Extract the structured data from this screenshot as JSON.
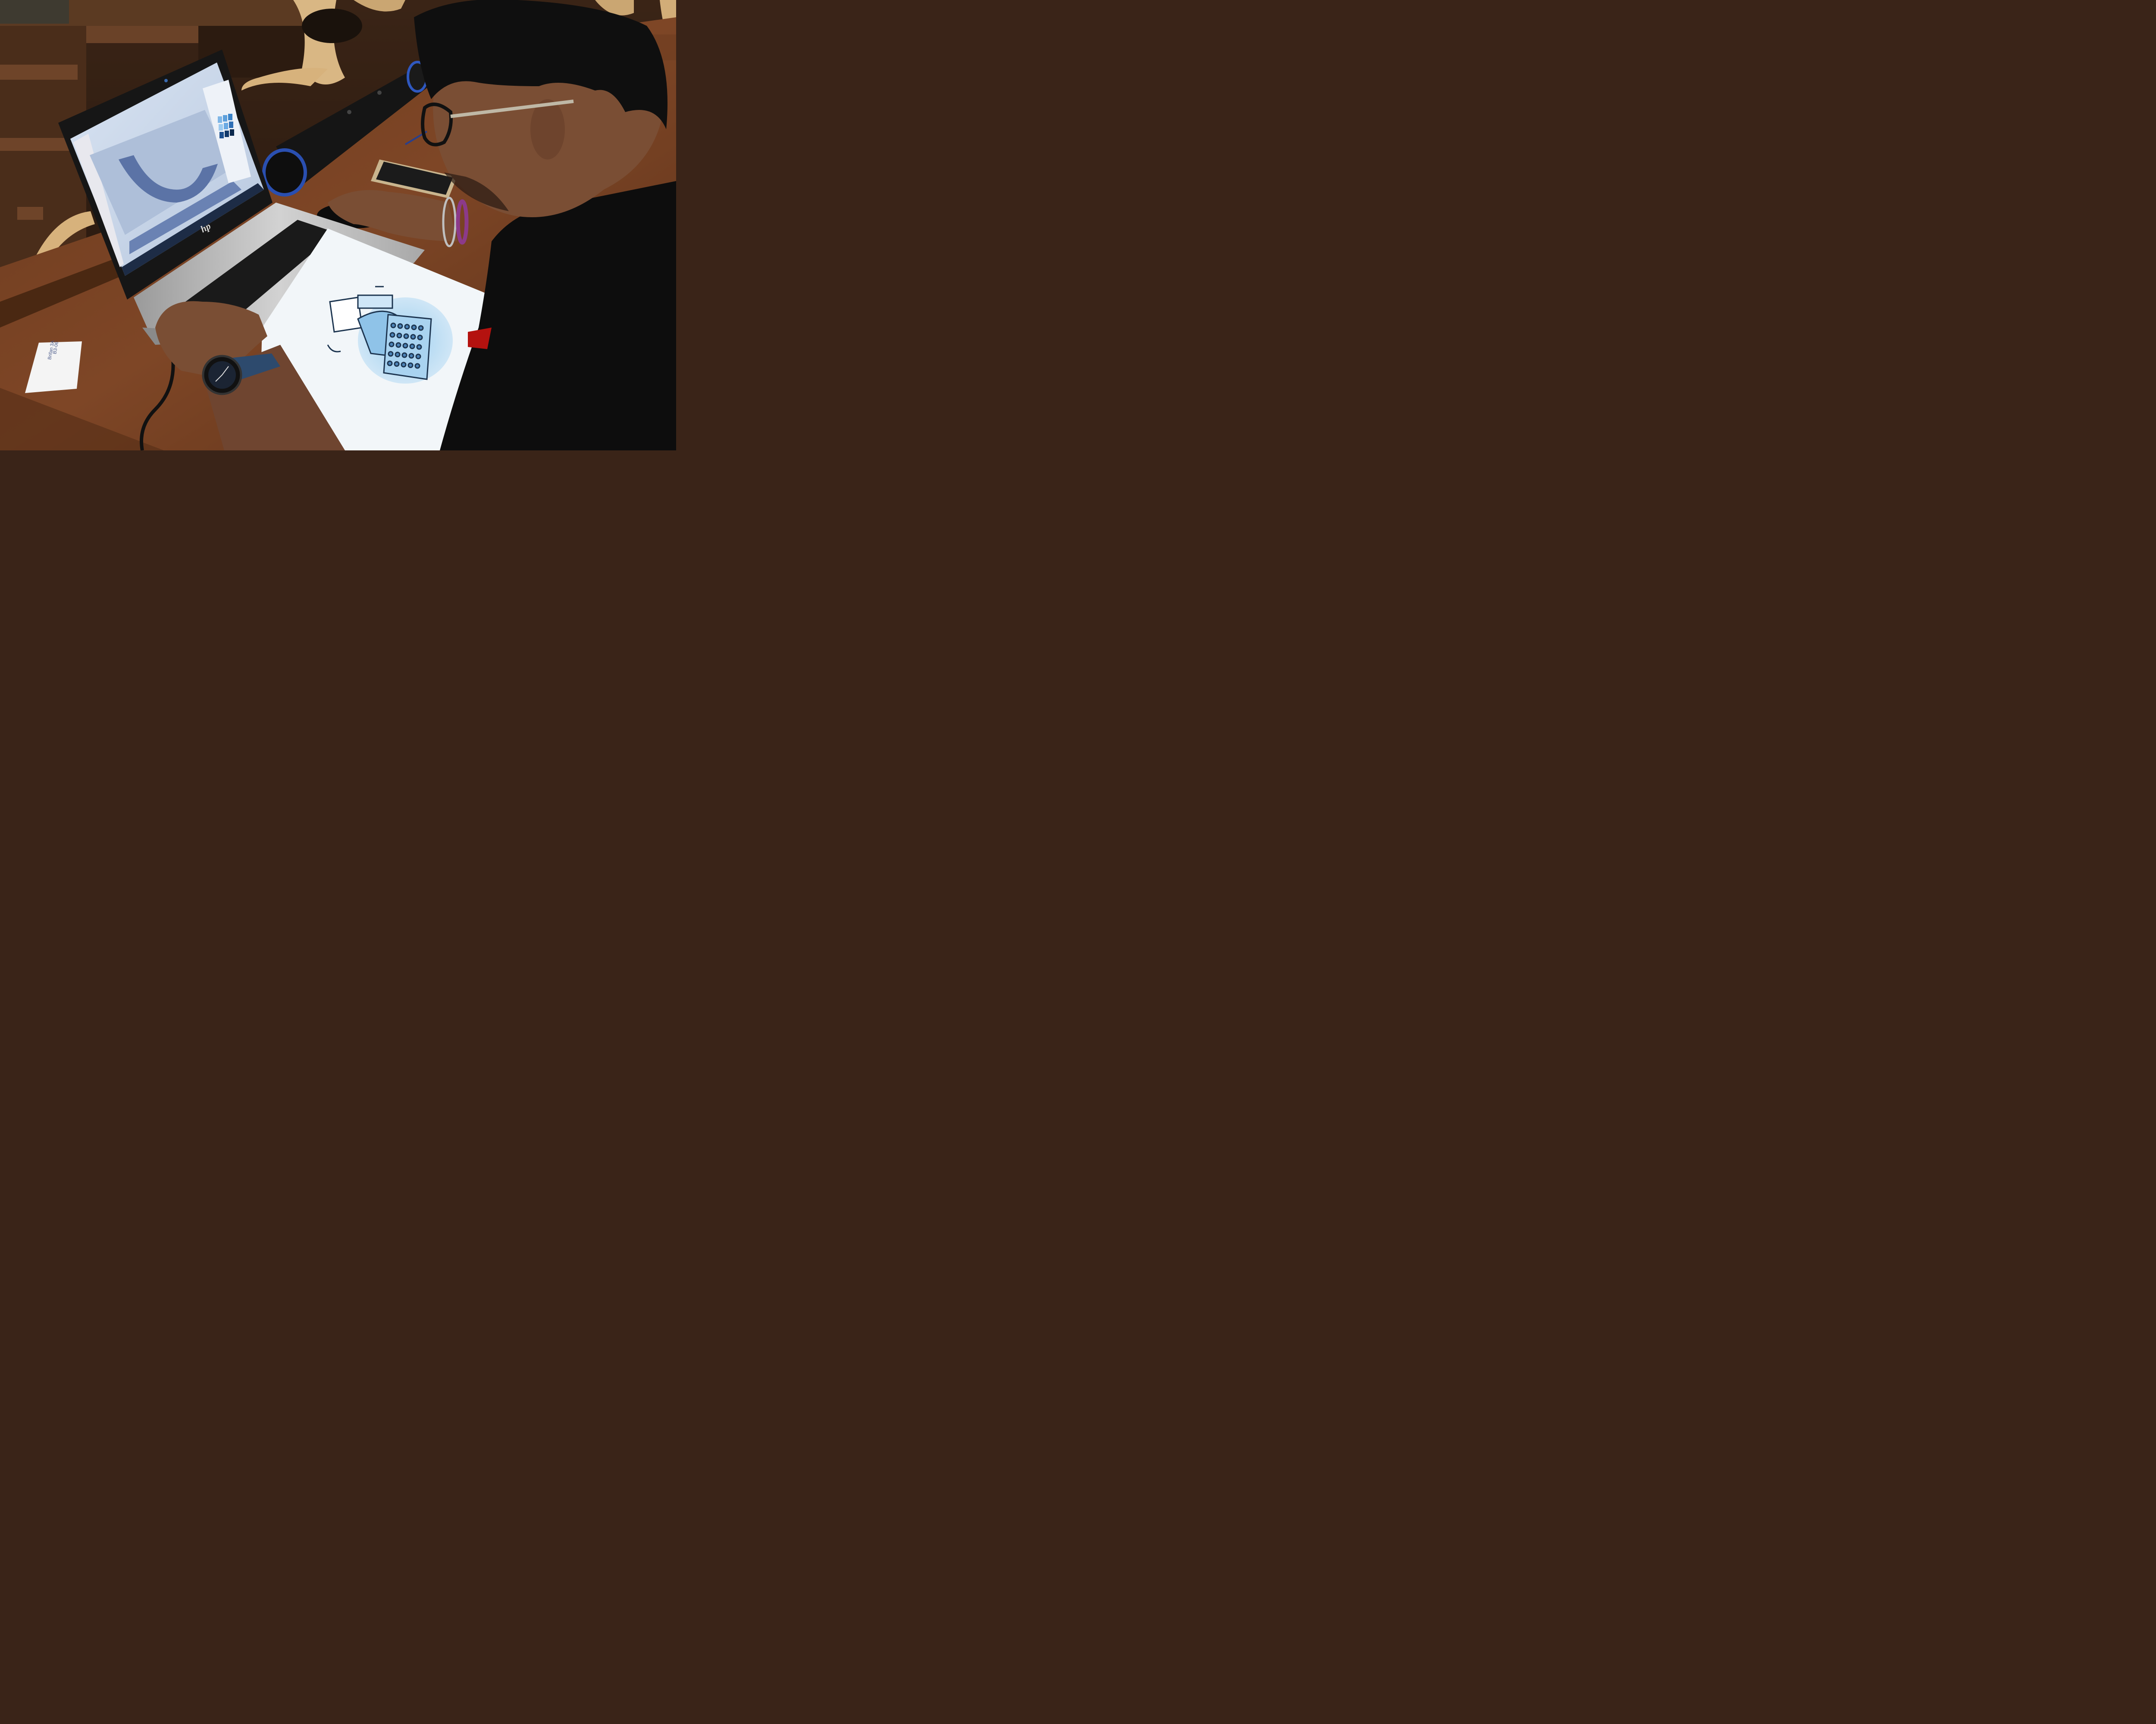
{
  "scene": {
    "laptop_brand": "hp",
    "note_lines": [
      "B3-06",
      "Brifan 3A"
    ],
    "screen_app": "3D modeling software",
    "colors": {
      "desk": "#7a4424",
      "desk_dark": "#4a2812",
      "laptop_silver": "#b9b9b9",
      "screen_bg": "#c9d7ea",
      "shirt": "#0d0d0d",
      "skin": "#7a4e34",
      "paper": "#f2f6f9",
      "typewriter_blue": "#8fc3e8"
    },
    "swatch_colors": [
      "#7fb6e6",
      "#5da0dc",
      "#3b84c9",
      "#9ccbf0",
      "#6aa9e3",
      "#2f6fb6",
      "#1c4f8f",
      "#12396a",
      "#0b284d"
    ]
  }
}
